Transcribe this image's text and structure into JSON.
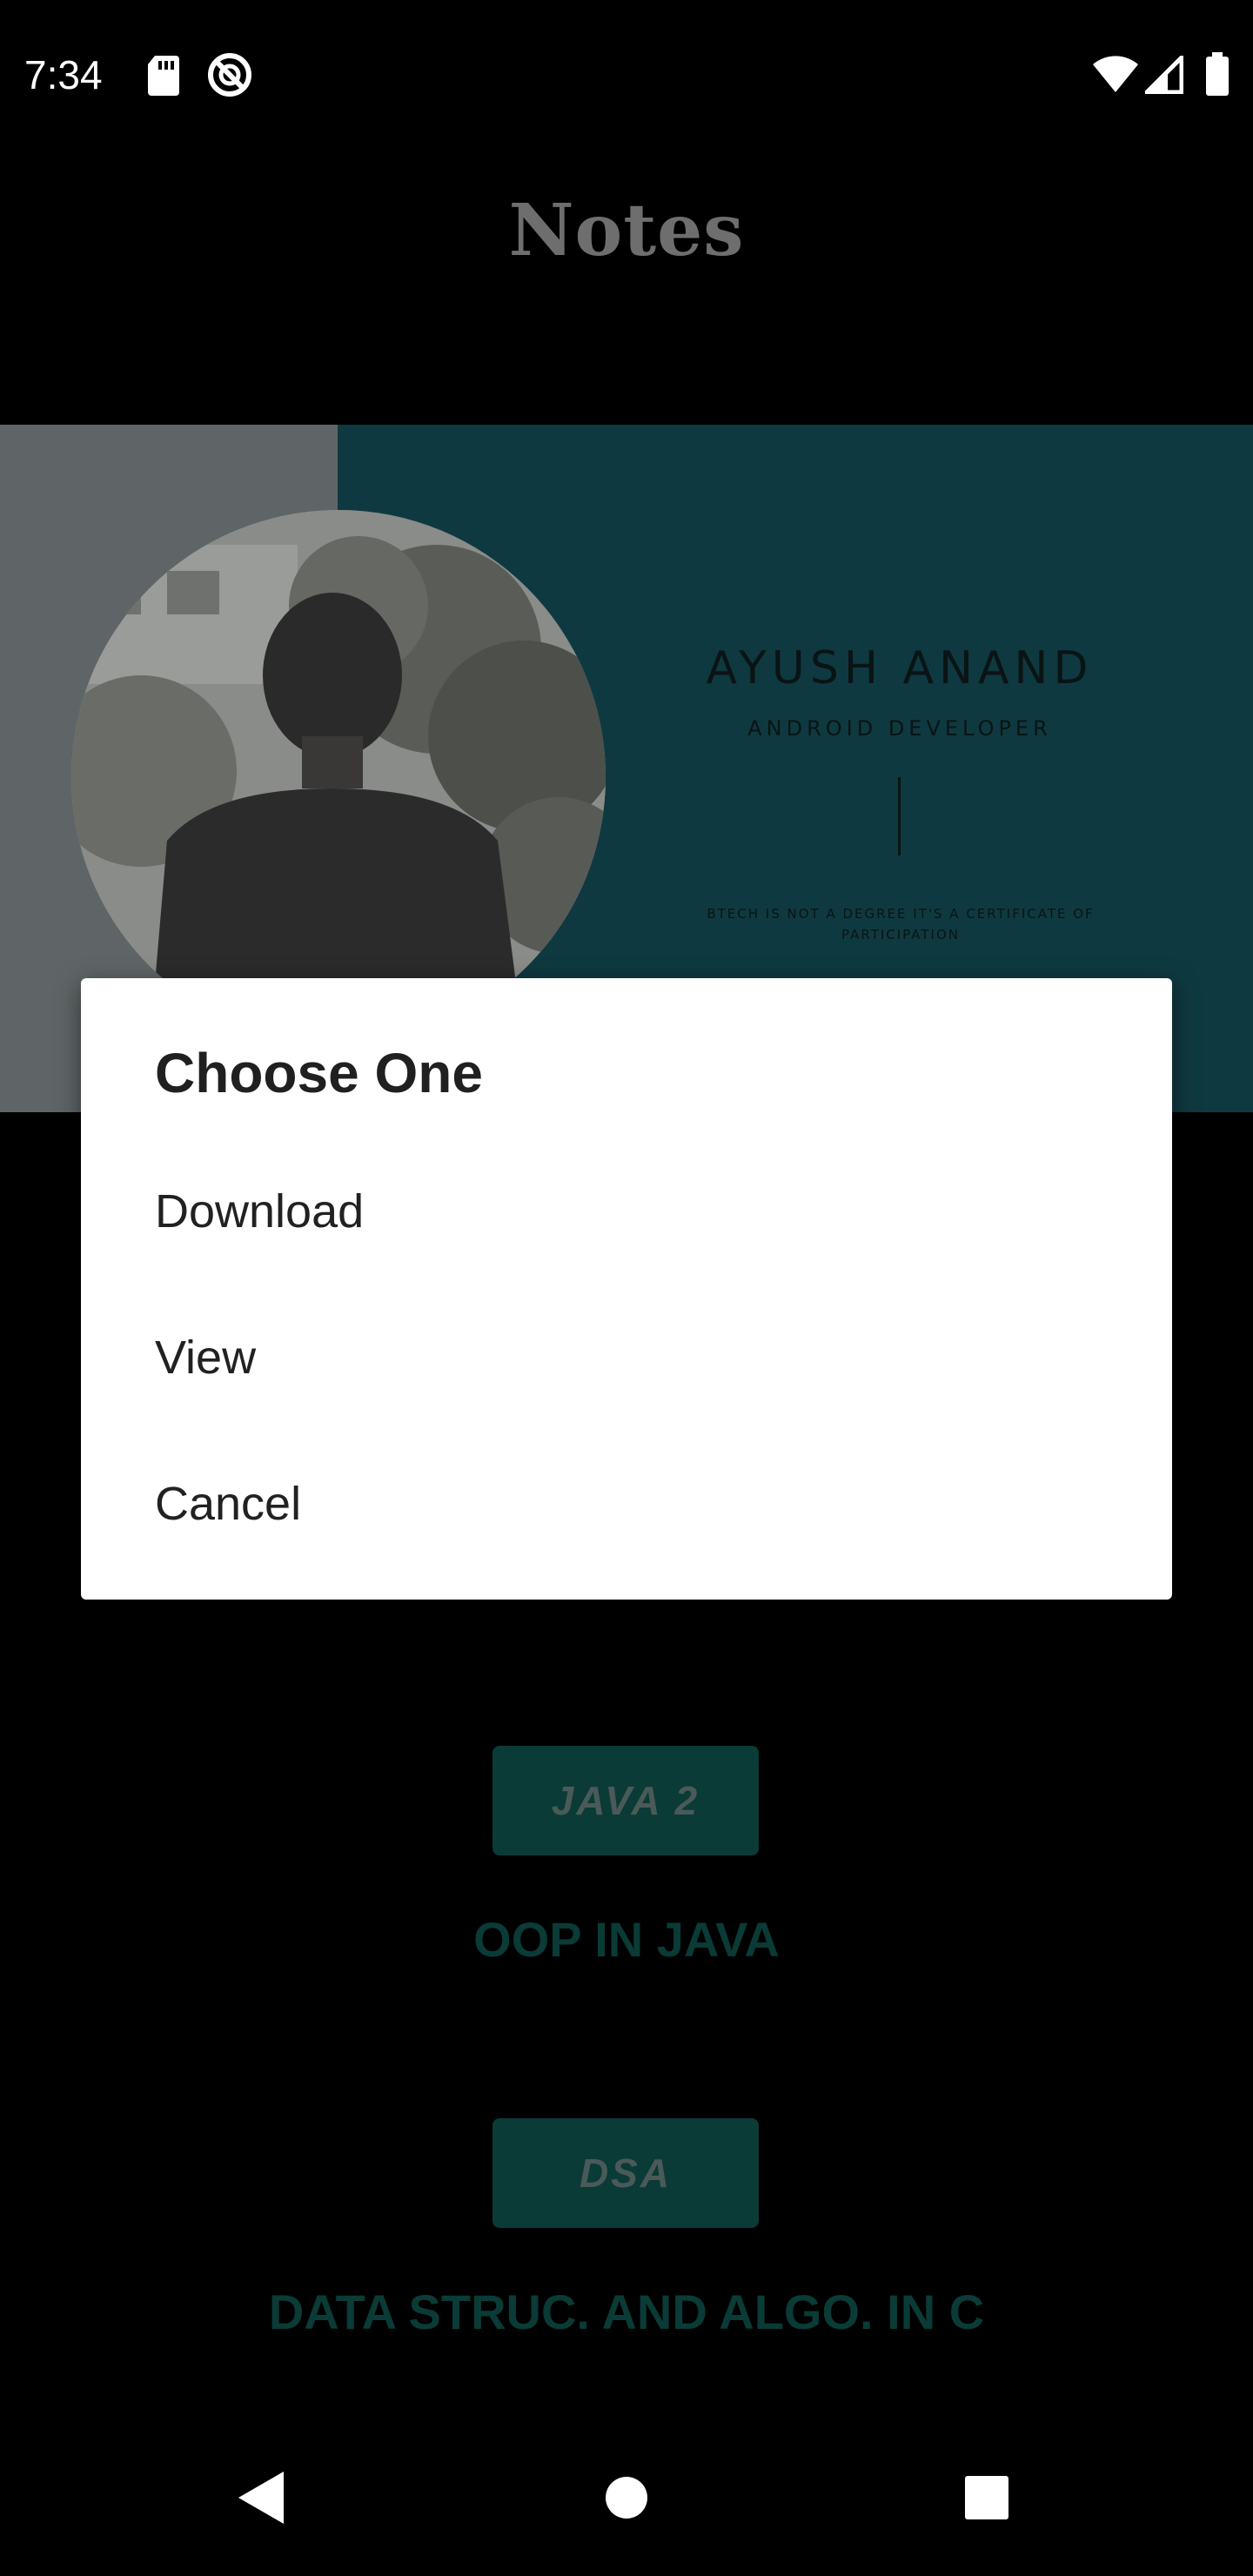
{
  "status_bar": {
    "time": "7:34",
    "icons": [
      "sd-card-icon",
      "do-not-disturb-icon",
      "wifi-icon",
      "signal-icon",
      "battery-icon"
    ]
  },
  "app": {
    "title": "Notes"
  },
  "banner": {
    "name": "AYUSH ANAND",
    "role": "ANDROID DEVELOPER",
    "quote": "BTECH IS NOT A DEGREE IT'S A CERTIFICATE OF PARTICIPATION"
  },
  "notes": [
    {
      "button_label": "JAVA 2",
      "title": "OOP IN JAVA"
    },
    {
      "button_label": "DSA",
      "title": "DATA STRUC. AND ALGO. IN C"
    }
  ],
  "dialog": {
    "title": "Choose One",
    "options": [
      {
        "label": "Download"
      },
      {
        "label": "View"
      },
      {
        "label": "Cancel"
      }
    ]
  },
  "colors": {
    "background": "#000000",
    "banner_teal": "#0f3940",
    "banner_grey": "#5f6566",
    "note_button": "#0a3b36",
    "dialog_bg": "#ffffff"
  }
}
